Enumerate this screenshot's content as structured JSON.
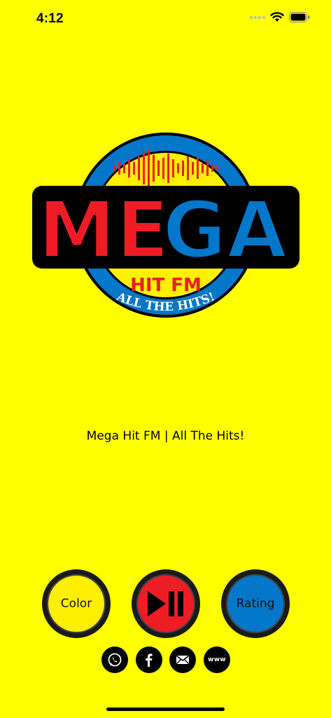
{
  "status": {
    "time": "4:12"
  },
  "logo": {
    "main_text": "MEGA",
    "sub_text": "HIT FM",
    "ring_text": "ALL THE HITS!"
  },
  "tagline": "Mega Hit FM | All The Hits!",
  "controls": {
    "color_label": "Color",
    "rating_label": "Rating",
    "play_icon": "play-pause-icon"
  },
  "social": {
    "icons": [
      "whatsapp-icon",
      "facebook-icon",
      "email-icon",
      "website-icon"
    ],
    "www_label": "www"
  },
  "colors": {
    "background": "#FFFF00",
    "red": "#EE1C25",
    "blue": "#0377C9",
    "yellow": "#FFEF00"
  }
}
